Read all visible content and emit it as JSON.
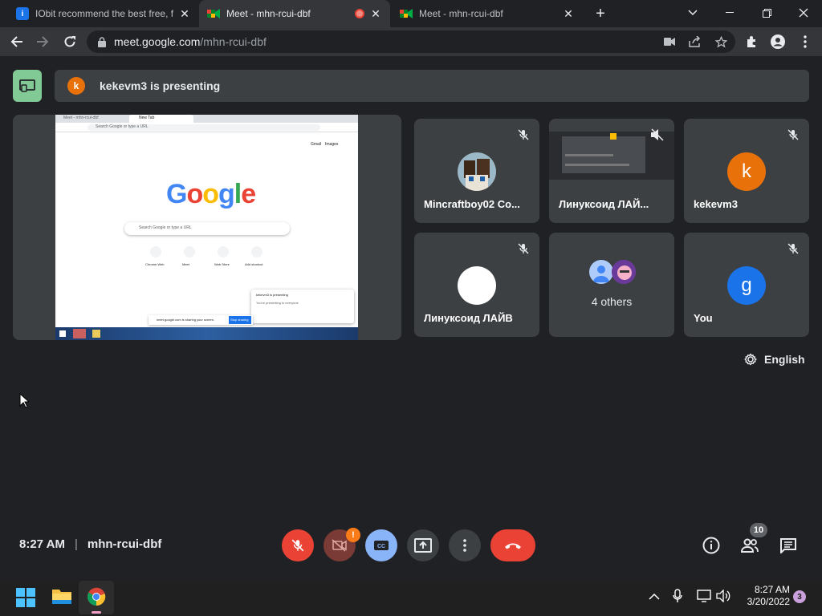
{
  "browser": {
    "tabs": [
      {
        "title": "IObit recommend the best free, f",
        "icon": "iobit-icon",
        "active": false
      },
      {
        "title": "Meet - mhn-rcui-dbf",
        "icon": "google-meet-icon",
        "active": true,
        "recording": true
      },
      {
        "title": "Meet - mhn-rcui-dbf",
        "icon": "google-meet-icon",
        "active": false
      }
    ],
    "url_host": "meet.google.com",
    "url_path": "/mhn-rcui-dbf"
  },
  "meet": {
    "presenter_initial": "k",
    "presenting_text": "kekevm3 is presenting",
    "shared_screen": {
      "tabs": [
        "Meet - mhn-rcui-dbf",
        "New Tab"
      ],
      "url": "Search Google or type a URL",
      "links": [
        "Gmail",
        "Images"
      ],
      "search_placeholder": "Search Google or type a URL",
      "shortcuts": [
        "Chrome Web",
        "Meet",
        "Web Store",
        "Add shortcut"
      ],
      "meet_bar_text": "meet.google.com is sharing your screen.",
      "stop_sharing": "Stop sharing",
      "notif_title": "kekevm3 is presenting",
      "notif_text": "You're presenting to everyone"
    },
    "participants": [
      {
        "name": "Mincraftboy02 Co...",
        "avatar": "photo",
        "muted": true
      },
      {
        "name": "Линуксоид ЛАЙ...",
        "avatar": "screen",
        "muted": true,
        "volume_off": true
      },
      {
        "name": "kekevm3",
        "initial": "k",
        "color": "#e8710a",
        "muted": true
      },
      {
        "name": "Линуксоид ЛАЙВ",
        "avatar": "white",
        "muted": true
      },
      {
        "name": "4 others",
        "avatar": "group",
        "muted": false
      },
      {
        "name": "You",
        "initial": "g",
        "color": "#1a73e8",
        "muted": true
      }
    ],
    "captions_language": "English",
    "time": "8:27 AM",
    "separator": "|",
    "meeting_code": "mhn-rcui-dbf",
    "camera_alert": "!",
    "people_count": "10"
  },
  "taskbar": {
    "time": "8:27 AM",
    "date": "3/20/2022",
    "notifications": "3"
  },
  "colors": {
    "bg": "#202124",
    "tile": "#3c4043",
    "danger": "#ea4335",
    "accent": "#8ab4f8",
    "present": "#81c995"
  }
}
